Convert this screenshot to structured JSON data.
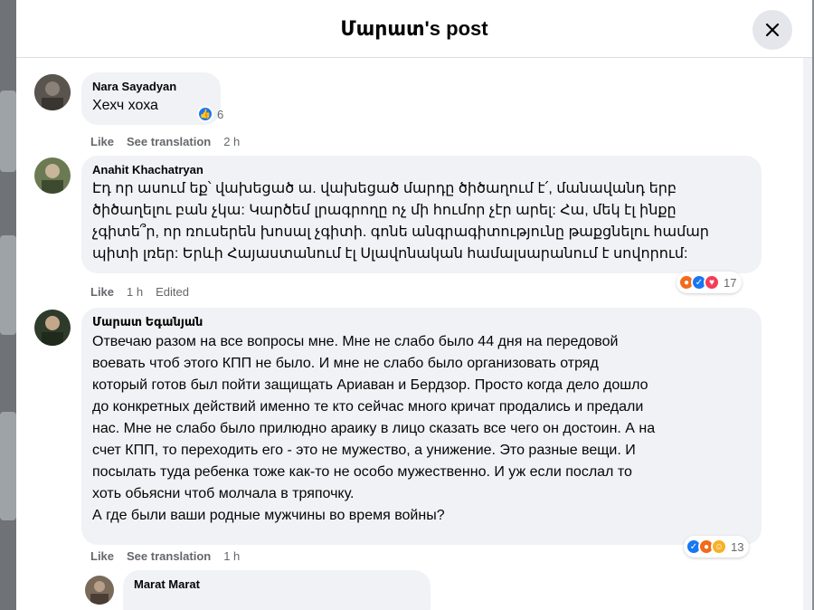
{
  "dialog": {
    "title": "Մարատ's post"
  },
  "comments": [
    {
      "author": "Nara Sayadyan",
      "text": "Хехч хоха",
      "actions": {
        "like": "Like",
        "translate": "See translation",
        "time": "2 h"
      },
      "reaction_count": "6"
    },
    {
      "author": "Anahit Khachatryan",
      "text": "Էդ որ ասում եք՝ վախեցած ա. վախեցած մարդը ծիծաղում է՛, մանավանդ երբ\nծիծաղելու բան չկա: Կարծեմ լրագրողը ոչ մի հումոր չէր արել: Հա, մեկ էլ ինքը\nչգիտե՞ր, որ ռուսերեն խոսալ չգիտի. գոնե անգրագիտությունը թաքցնելու համար\nպիտի լռեր: Երևի Հայաստանում էլ Սլավոնական համալսարանում է սովորում:",
      "actions": {
        "like": "Like",
        "time": "1 h",
        "edited": "Edited"
      },
      "reaction_count": "17"
    },
    {
      "author": "Մարատ Եգանյան",
      "text": "Отвечаю разом на все вопросы мне. Мне не слабо было 44 дня на передовой\nвоевать чтоб этого КПП не было. И мне не слабо было организовать отряд\nкоторый готов был пойти защищать Ариаван и Бердзор. Просто когда дело дошло\nдо конкретных действий именно те кто сейчас много кричат продались и предали\nнас. Мне не слабо было прилюдно араику в лицо сказать все чего он достоин. А на\nсчет КПП, то переходить его - это не мужество, а унижение. Это разные вещи. И\nпосылать туда ребенка тоже как-то не особо мужественно. И уж если послал то\nхоть обьясни чтоб молчала в тряпочку.\nА где были ваши родные мужчины во время войны?",
      "actions": {
        "like": "Like",
        "translate": "See translation",
        "time": "1 h"
      },
      "reaction_count": "13"
    },
    {
      "author": "Marat Marat",
      "text": ""
    }
  ],
  "icons": {
    "close": "close-icon",
    "like": "like-reaction-icon",
    "angry": "angry-reaction-icon",
    "love": "love-reaction-icon",
    "care": "care-reaction-icon"
  },
  "colors": {
    "bubble": "#f0f2f5",
    "like": "#1877f2",
    "angry": "#f26a1b",
    "love": "#f33e58",
    "care": "#f7b125"
  }
}
